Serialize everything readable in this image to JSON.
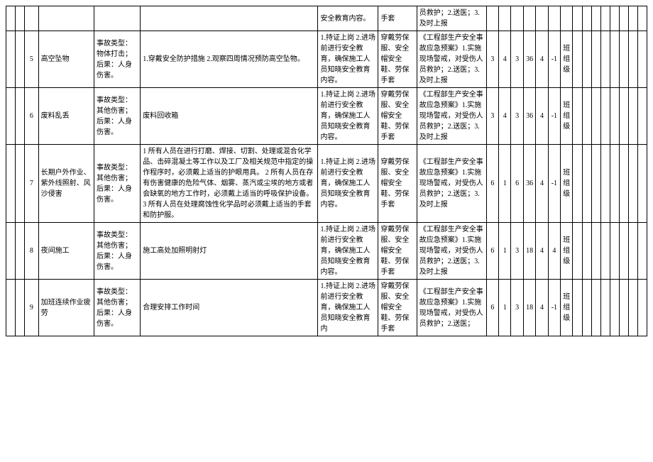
{
  "rows": [
    {
      "idx": "",
      "hazard": "",
      "type": "",
      "measure": "",
      "train": "安全教育内容。",
      "ppe": "手套",
      "plan": "员救护；2.送医；3.及时上报",
      "n1": "",
      "n2": "",
      "n3": "",
      "n4": "",
      "n5": "",
      "n6": "",
      "level": ""
    },
    {
      "idx": "5",
      "hazard": "高空坠物",
      "type": "事故类型：物体打击；后果：人身伤害。",
      "measure": "1.穿戴安全防护措施 2.观察四周情况预防高空坠物。",
      "train": "1.持证上岗 2.进场前进行安全教育，确保施工人员知晓安全教育内容。",
      "ppe": "穿戴劳保服、安全帽安全鞋、劳保手套",
      "plan": "《工程部生产安全事故应急预案》1.实施现场警戒，对受伤人员救护；2.送医；3.及时上报",
      "n1": "3",
      "n2": "4",
      "n3": "3",
      "n4": "36",
      "n5": "4",
      "n6": "-1",
      "level": "班组级"
    },
    {
      "idx": "6",
      "hazard": "废料乱丢",
      "type": "事故类型：其他伤害；后果：人身伤害。",
      "measure": "废料回收箱",
      "train": "1.持证上岗 2.进场前进行安全教育，确保施工人员知晓安全教育内容。",
      "ppe": "穿戴劳保服、安全帽安全鞋、劳保手套",
      "plan": "《工程部生产安全事故应急预案》1.实施现场警戒，对受伤人员救护；2.送医；3.及时上报",
      "n1": "3",
      "n2": "4",
      "n3": "3",
      "n4": "36",
      "n5": "4",
      "n6": "-1",
      "level": "班组级"
    },
    {
      "idx": "7",
      "hazard": "长期户外作业、紫外线照射、风沙侵害",
      "type": "事故类型：其他伤害；后果：人身伤害。",
      "measure": "1 所有人员在进行打磨、焊接、切割、处理或混合化学品、击碎混凝土等工作以及工厂及相关规范中指定的操作程序时，必须戴上适当的护眼用具。\n2 所有人员在存有伤害健康的危险气体、烟雾、蒸汽或尘埃的地方或者会缺氧的地方工作时，必须戴上适当的呼吸保护设备。\n3 所有人员在处理腐蚀性化学品时必须戴上适当的手套和防护服。",
      "train": "1.持证上岗 2.进场前进行安全教育，确保施工人员知晓安全教育内容。",
      "ppe": "穿戴劳保服、安全帽安全鞋、劳保手套",
      "plan": "《工程部生产安全事故应急预案》1.实施现场警戒，对受伤人员救护；2.送医；3.及时上报",
      "n1": "6",
      "n2": "1",
      "n3": "6",
      "n4": "36",
      "n5": "4",
      "n6": "-1",
      "level": "班组级"
    },
    {
      "idx": "8",
      "hazard": "夜间施工",
      "type": "事故类型：其他伤害；后果：人身伤害。",
      "measure": "施工高处加照明射灯",
      "train": "1.持证上岗 2.进场前进行安全教育，确保施工人员知晓安全教育内容。",
      "ppe": "穿戴劳保服、安全帽安全鞋、劳保手套",
      "plan": "《工程部生产安全事故应急预案》1.实施现场警戒，对受伤人员救护；2.送医；3.及时上报",
      "n1": "6",
      "n2": "1",
      "n3": "3",
      "n4": "18",
      "n5": "4",
      "n6": "4",
      "level": "班组级"
    },
    {
      "idx": "9",
      "hazard": "加班连续作业疲劳",
      "type": "事故类型：其他伤害；后果：人身伤害。",
      "measure": "合理安排工作时间",
      "train": "1.持证上岗 2.进场前进行安全教育，确保施工人员知晓安全教育内",
      "ppe": "穿戴劳保服、安全帽安全鞋、劳保手套",
      "plan": "《工程部生产安全事故应急预案》1.实施现场警戒，对受伤人员救护；2.送医；",
      "n1": "6",
      "n2": "1",
      "n3": "3",
      "n4": "18",
      "n5": "4",
      "n6": "-1",
      "level": "班组级"
    }
  ]
}
